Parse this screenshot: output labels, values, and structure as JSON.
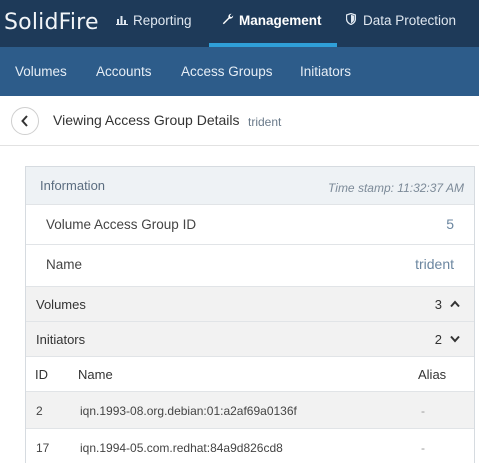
{
  "topnav": {
    "logo": "SolidFire",
    "items": [
      {
        "label": "Reporting",
        "icon": "bar-chart-icon"
      },
      {
        "label": "Management",
        "icon": "wrench-icon",
        "active": true
      },
      {
        "label": "Data Protection",
        "icon": "shield-icon"
      }
    ]
  },
  "subnav": {
    "items": [
      {
        "label": "Volumes"
      },
      {
        "label": "Accounts"
      },
      {
        "label": "Access Groups"
      },
      {
        "label": "Initiators"
      }
    ]
  },
  "header": {
    "back_icon": "chevron-left-icon",
    "title": "Viewing Access Group Details",
    "subtitle": "trident"
  },
  "panel": {
    "info_title": "Information",
    "timestamp": "Time stamp: 11:32:37 AM",
    "fields": [
      {
        "label": "Volume Access Group ID",
        "value": "5"
      },
      {
        "label": "Name",
        "value": "trident"
      }
    ],
    "sections": [
      {
        "label": "Volumes",
        "count": "3",
        "icon": "chevron-up-icon"
      },
      {
        "label": "Initiators",
        "count": "2",
        "icon": "chevron-down-icon"
      }
    ],
    "table": {
      "columns": [
        "ID",
        "Name",
        "Alias"
      ],
      "rows": [
        {
          "id": "2",
          "name": "iqn.1993-08.org.debian:01:a2af69a0136f",
          "alias": "-"
        },
        {
          "id": "17",
          "name": "iqn.1994-05.com.redhat:84a9d826cd8",
          "alias": "-"
        }
      ]
    }
  },
  "colors": {
    "topnav_bg": "#1e3a59",
    "subnav_bg": "#2d5c8a",
    "accent": "#2f9fd8"
  }
}
